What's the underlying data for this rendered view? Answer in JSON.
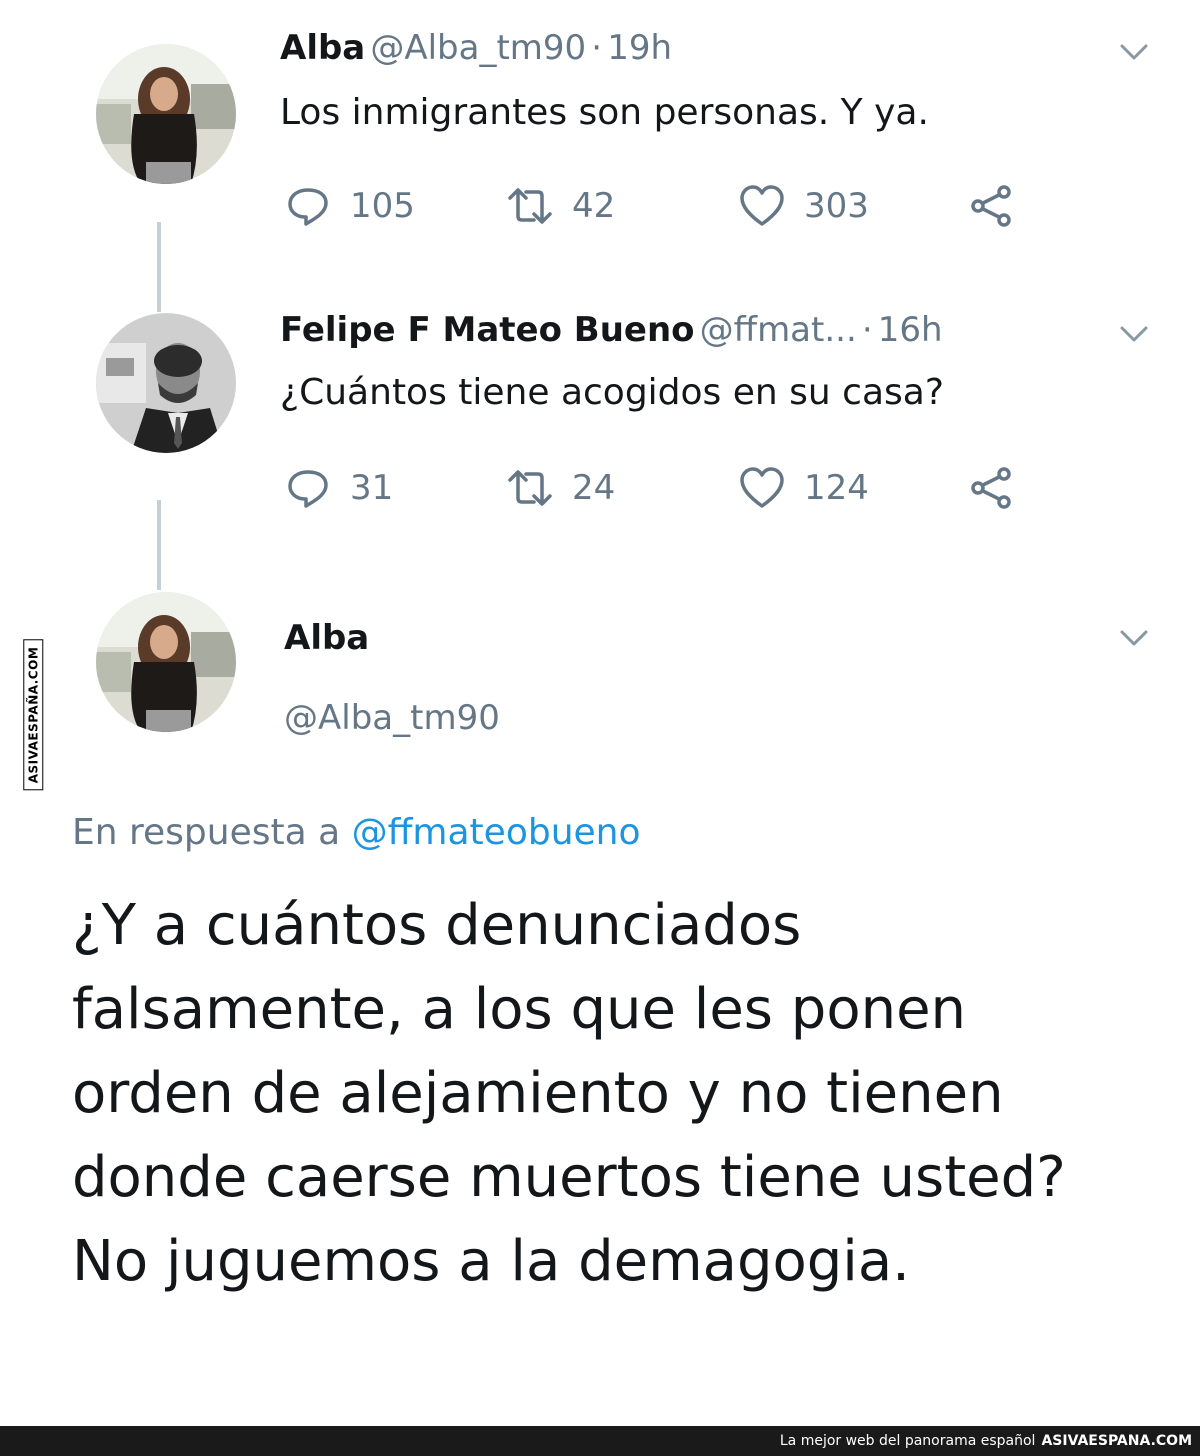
{
  "tweets": [
    {
      "name": "Alba",
      "handle": "@Alba_tm90",
      "separator": "·",
      "time": "19h",
      "text": "Los inmigrantes son personas. Y ya.",
      "replies": "105",
      "retweets": "42",
      "likes": "303"
    },
    {
      "name": "Felipe F Mateo Bueno",
      "handle": "@ffmat...",
      "separator": "·",
      "time": "16h",
      "text": "¿Cuántos tiene acogidos en su casa?",
      "replies": "31",
      "retweets": "24",
      "likes": "124"
    }
  ],
  "main_tweet": {
    "name": "Alba",
    "handle": "@Alba_tm90",
    "reply_prefix": "En respuesta a",
    "reply_handle": "@ffmateobueno",
    "text": "¿Y a cuántos denunciados falsamente, a los que les ponen orden de alejamiento y no tienen donde caerse muertos tiene usted? No juguemos a la demagogia."
  },
  "watermark": {
    "side": "ASIVAESPAÑA.COM",
    "footer_tagline": "La mejor web del panorama español",
    "footer_brand": "ASIVAESPANA.COM"
  },
  "colors": {
    "text": "#14171a",
    "secondary": "#657786",
    "link": "#1b95e0",
    "thread_line": "#c4cfd6"
  },
  "icons": [
    "reply-icon",
    "retweet-icon",
    "like-icon",
    "share-icon",
    "chevron-down-icon"
  ]
}
